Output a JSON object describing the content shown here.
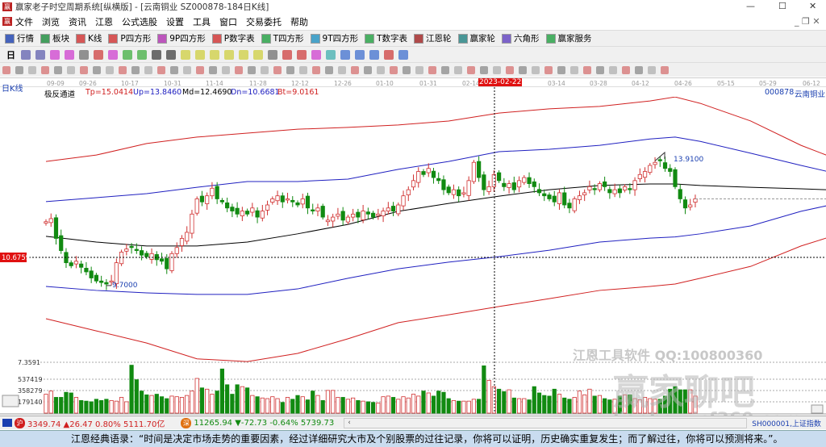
{
  "window": {
    "title": "赢家老子时空周期系统[纵横版] - [云南铜业  SZ000878-184日K线]"
  },
  "menu": [
    "文件",
    "浏览",
    "资讯",
    "江恩",
    "公式选股",
    "设置",
    "工具",
    "窗口",
    "交易委托",
    "帮助"
  ],
  "toolbar1": [
    {
      "label": "行情",
      "icon": "quote-grid-icon",
      "color": "#1a3fb0"
    },
    {
      "label": "板块",
      "icon": "sector-blocks-icon",
      "color": "#1a8a3a"
    },
    {
      "label": "K线",
      "icon": "candlestick-icon",
      "color": "#d03030"
    },
    {
      "label": "P四方形",
      "icon": "p-square-icon",
      "color": "#d03030"
    },
    {
      "label": "9P四方形",
      "icon": "9p-square-icon",
      "color": "#b030b0"
    },
    {
      "label": "P数字表",
      "icon": "p-number-table-icon",
      "color": "#d03030"
    },
    {
      "label": "T四方形",
      "icon": "t-square-icon",
      "color": "#20a040"
    },
    {
      "label": "9T四方形",
      "icon": "9t-square-icon",
      "color": "#2090c0"
    },
    {
      "label": "T数字表",
      "icon": "t-number-table-icon",
      "color": "#20a040"
    },
    {
      "label": "江恩轮",
      "icon": "gann-wheel-icon",
      "color": "#a02020"
    },
    {
      "label": "赢家轮",
      "icon": "winner-wheel-icon",
      "color": "#208080"
    },
    {
      "label": "六角形",
      "icon": "hexagon-icon",
      "color": "#6040c0"
    },
    {
      "label": "赢家服务",
      "icon": "dollar-service-icon",
      "color": "#20a040"
    }
  ],
  "toolbar2_period": "日",
  "axis_dates": [
    "09-09",
    "09-26",
    "10-17",
    "10-31",
    "11-14",
    "11-28",
    "12-12",
    "12-26",
    "01-10",
    "01-31",
    "02-14",
    "03-14",
    "03-28",
    "04-12",
    "04-26",
    "05-15",
    "05-29",
    "06-12"
  ],
  "crosshair_date": "2023-02-22",
  "period_label": "日K线",
  "indicator": {
    "name": "极反通道",
    "tp": "Tp=15.0414",
    "up": "Up=13.8460",
    "md": "Md=12.4690",
    "dn": "Dn=10.6681",
    "bt": "Bt=9.0161"
  },
  "stock": {
    "code": "000878",
    "name": "云南铜业"
  },
  "price_cursor": "10.6759",
  "annotations": {
    "high": "13.9100",
    "low": "9.7000"
  },
  "volume_labels": [
    "7.3591",
    "537419",
    "358279",
    "179140"
  ],
  "colors": {
    "up": "#d03030",
    "down": "#118a11",
    "tp": "#d02020",
    "up_band": "#2020c0",
    "md": "#000000",
    "dn_band": "#2020c0",
    "bt": "#d02020"
  },
  "chart_data": {
    "type": "candlestick",
    "closes": [
      11.85,
      11.95,
      11.3,
      10.9,
      10.5,
      10.4,
      10.55,
      10.35,
      10.2,
      10.0,
      9.9,
      9.85,
      9.8,
      9.9,
      10.5,
      10.85,
      10.95,
      11.0,
      10.9,
      10.75,
      10.7,
      10.8,
      10.6,
      10.55,
      10.3,
      10.8,
      11.0,
      11.3,
      11.5,
      12.1,
      12.6,
      12.5,
      12.7,
      12.95,
      12.6,
      12.5,
      12.3,
      12.2,
      12.1,
      12.2,
      12.1,
      12.3,
      12.0,
      12.2,
      12.4,
      12.6,
      12.7,
      12.5,
      12.6,
      12.5,
      12.4,
      12.6,
      12.3,
      12.2,
      12.3,
      12.0,
      11.9,
      12.0,
      12.1,
      11.9,
      12.0,
      12.1,
      12.0,
      12.2,
      12.1,
      12.0,
      12.1,
      12.2,
      12.3,
      12.2,
      12.4,
      12.7,
      12.9,
      13.2,
      13.5,
      13.4,
      13.6,
      13.3,
      13.2,
      12.9,
      12.8,
      12.9,
      12.7,
      12.8,
      13.2,
      13.8,
      13.3,
      12.9,
      13.0,
      13.4,
      13.2,
      13.0,
      13.1,
      12.9,
      13.2,
      13.3,
      13.1,
      13.0,
      12.8,
      12.7,
      12.6,
      12.5,
      12.8,
      12.4,
      12.3,
      12.6,
      12.7,
      12.8,
      13.0,
      12.9,
      13.1,
      13.0,
      12.8,
      12.9,
      12.8,
      13.0,
      12.9,
      13.2,
      13.4,
      13.5,
      13.7,
      13.8,
      13.85,
      13.6,
      13.5,
      13.0,
      12.6,
      12.3,
      12.4,
      12.6
    ],
    "volumes": [
      300000,
      350000,
      250000,
      250000,
      330000,
      320000,
      250000,
      200000,
      190000,
      180000,
      220000,
      200000,
      220000,
      200000,
      190000,
      250000,
      180000,
      760000,
      530000,
      350000,
      290000,
      280000,
      300000,
      260000,
      230000,
      270000,
      260000,
      250000,
      280000,
      350000,
      550000,
      400000,
      380000,
      300000,
      350000,
      700000,
      450000,
      300000,
      450000,
      420000,
      400000,
      280000,
      260000,
      240000,
      230000,
      260000,
      230000,
      170000,
      250000,
      220000,
      280000,
      260000,
      210000,
      350000,
      280000,
      200000,
      360000,
      360000,
      250000,
      250000,
      220000,
      240000,
      200000,
      190000,
      180000,
      170000,
      160000,
      260000,
      270000,
      250000,
      220000,
      260000,
      240000,
      300000,
      270000,
      350000,
      320000,
      270000,
      350000,
      330000,
      230000,
      200000,
      190000,
      190000,
      190000,
      220000,
      220000,
      750000,
      520000,
      420000,
      380000,
      340000,
      370000,
      240000,
      230000,
      230000,
      210000,
      420000,
      320000,
      280000,
      270000,
      380000,
      300000,
      240000,
      220000,
      250000,
      350000,
      290000,
      380000,
      270000,
      280000,
      230000,
      210000,
      220000,
      270000,
      290000,
      290000,
      230000,
      210000,
      250000,
      230000,
      220000,
      220000,
      270000,
      380000,
      420000,
      370000,
      370000,
      370000,
      270000
    ],
    "bands": {
      "index": [
        0,
        10,
        20,
        30,
        40,
        50,
        60,
        70,
        80,
        90,
        100,
        110,
        120,
        125,
        130,
        140,
        150,
        155
      ],
      "tp": [
        13.83,
        14.04,
        14.42,
        14.63,
        14.76,
        14.89,
        14.95,
        15.03,
        15.16,
        15.42,
        15.56,
        15.64,
        15.82,
        15.95,
        15.74,
        15.16,
        14.36,
        14.04
      ],
      "up": [
        12.51,
        12.64,
        12.77,
        12.98,
        13.17,
        13.17,
        13.25,
        13.57,
        13.83,
        14.15,
        14.23,
        14.36,
        14.57,
        14.63,
        14.49,
        14.1,
        13.7,
        13.51
      ],
      "md": [
        11.37,
        11.18,
        11.05,
        11.05,
        11.18,
        11.45,
        11.76,
        12.19,
        12.45,
        12.69,
        12.9,
        13.04,
        13.09,
        13.09,
        13.04,
        12.98,
        12.93,
        12.9
      ],
      "dn": [
        9.72,
        9.59,
        9.51,
        9.46,
        9.46,
        9.64,
        9.99,
        10.3,
        10.52,
        10.7,
        10.91,
        11.18,
        11.31,
        11.35,
        11.45,
        11.71,
        12.19,
        12.37
      ],
      "bt": [
        8.66,
        8.26,
        7.86,
        7.34,
        7.25,
        7.52,
        8.0,
        8.53,
        8.79,
        9.06,
        9.32,
        9.59,
        9.72,
        9.8,
        9.99,
        10.38,
        11.05,
        11.31
      ]
    }
  },
  "watermark": {
    "line1": "江恩工具软件  QQ:100800360",
    "line2": "赢家聊吧",
    "line3": "liaoba.yjcf360.com"
  },
  "status": {
    "sh_badge": "沪",
    "sh": "3349.74 ▲26.47 0.80% 5111.70亿",
    "sz_badge": "深",
    "sz": "11265.94 ▼-72.73 -0.64% 5739.73",
    "index": "SH000001,上证指数"
  },
  "quote": "江恩经典语录：“时间是决定市场走势的重要因素，经过详细研究大市及个别股票的过往记录，你将可以证明，历史确实重复发生；而了解过往，你将可以预测将来。”。"
}
